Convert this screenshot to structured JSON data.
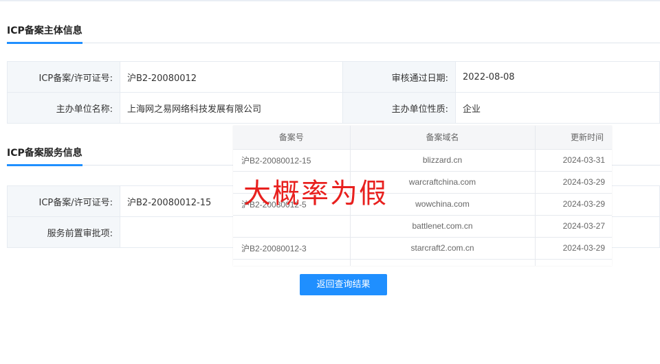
{
  "section1": {
    "title": "ICP备案主体信息",
    "license_label": "ICP备案/许可证号:",
    "license_value": "沪B2-20080012",
    "approve_date_label": "审核通过日期:",
    "approve_date_value": "2022-08-08",
    "org_name_label": "主办单位名称:",
    "org_name_value": "上海网之易网络科技发展有限公司",
    "org_type_label": "主办单位性质:",
    "org_type_value": "企业"
  },
  "section2": {
    "title": "ICP备案服务信息",
    "license_label": "ICP备案/许可证号:",
    "license_value": "沪B2-20080012-15",
    "pre_approval_label": "服务前置审批项:",
    "pre_approval_value": ""
  },
  "overlay_table": {
    "headers": [
      "备案号",
      "备案域名",
      "更新时间"
    ],
    "rows": [
      {
        "no": "沪B2-20080012-15",
        "domain": "blizzard.cn",
        "date": "2024-03-31"
      },
      {
        "no": "",
        "domain": "warcraftchina.com",
        "date": "2024-03-29"
      },
      {
        "no": "沪B2-20080012-5",
        "domain": "wowchina.com",
        "date": "2024-03-29"
      },
      {
        "no": "",
        "domain": "battlenet.com.cn",
        "date": "2024-03-27"
      },
      {
        "no": "沪B2-20080012-3",
        "domain": "starcraft2.com.cn",
        "date": "2024-03-29"
      },
      {
        "no": "",
        "domain": "",
        "date": ""
      }
    ]
  },
  "watermark": "大概率为假",
  "back_button": "返回查询结果",
  "colors": {
    "accent": "#1f8fff",
    "link": "#2d7bd0",
    "watermark": "#e8201e"
  }
}
